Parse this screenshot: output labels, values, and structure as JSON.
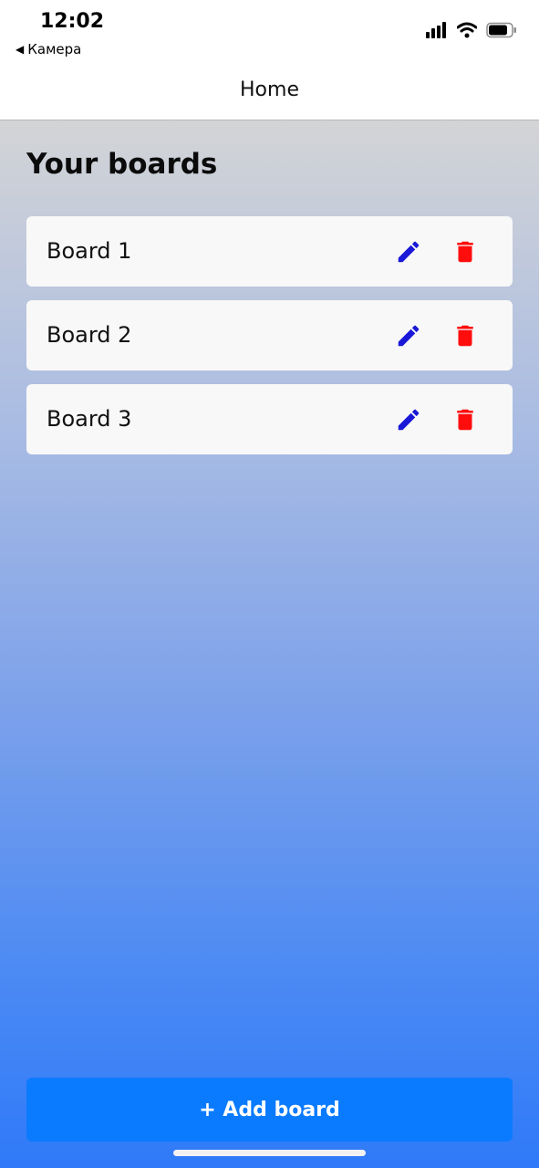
{
  "status_bar": {
    "time": "12:02",
    "back_app": "Камера",
    "icons": [
      "signal-icon",
      "wifi-icon",
      "battery-icon"
    ]
  },
  "nav": {
    "title": "Home"
  },
  "main": {
    "section_title": "Your boards",
    "boards": [
      {
        "name": "Board 1"
      },
      {
        "name": "Board 2"
      },
      {
        "name": "Board 3"
      }
    ],
    "add_button_label": "+ Add board"
  },
  "colors": {
    "edit_icon": "#1a18d8",
    "delete_icon": "#ff0d0d",
    "add_button": "#0a7bff",
    "card_background": "#f8f8f8"
  }
}
